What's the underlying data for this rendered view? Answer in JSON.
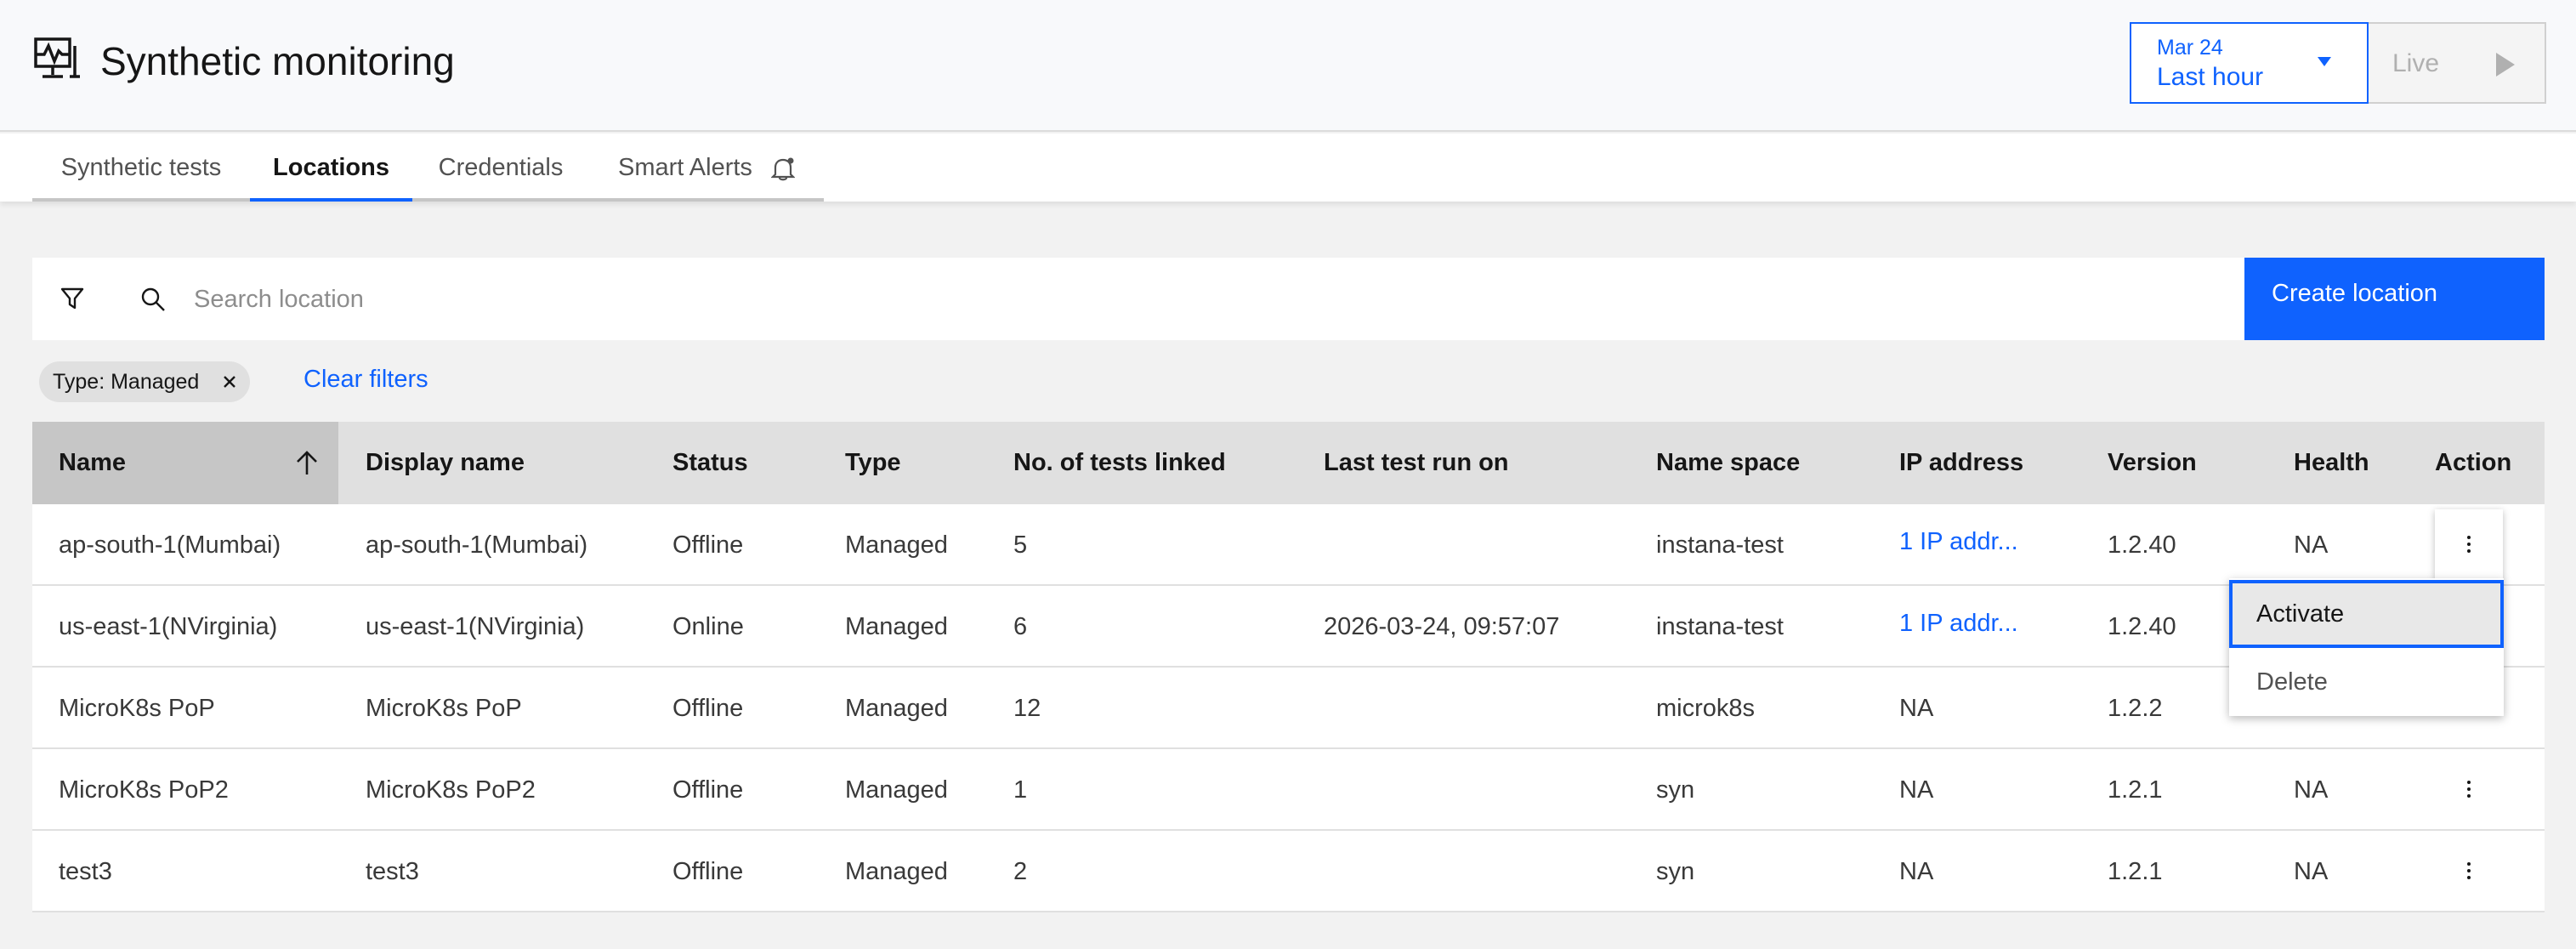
{
  "header": {
    "title": "Synthetic monitoring",
    "date_day": "Mar 24",
    "date_range": "Last hour",
    "live_label": "Live"
  },
  "tabs": [
    {
      "label": "Synthetic tests"
    },
    {
      "label": "Locations"
    },
    {
      "label": "Credentials"
    },
    {
      "label": "Smart Alerts"
    }
  ],
  "active_tab": "Locations",
  "toolbar": {
    "search_placeholder": "Search location",
    "create_label": "Create location"
  },
  "filters": {
    "tag_label": "Type: Managed",
    "clear_label": "Clear filters"
  },
  "table": {
    "columns": [
      "Name",
      "Display name",
      "Status",
      "Type",
      "No. of tests linked",
      "Last test run on",
      "Name space",
      "IP address",
      "Version",
      "Health",
      "Action"
    ],
    "rows": [
      {
        "name": "ap-south-1(Mumbai)",
        "display": "ap-south-1(Mumbai)",
        "status": "Offline",
        "type": "Managed",
        "tests": "5",
        "last_run": "",
        "namespace": "instana-test",
        "ip": "1 IP addr...",
        "version": "1.2.40",
        "health": "NA"
      },
      {
        "name": "us-east-1(NVirginia)",
        "display": "us-east-1(NVirginia)",
        "status": "Online",
        "type": "Managed",
        "tests": "6",
        "last_run": "2026-03-24, 09:57:07",
        "namespace": "instana-test",
        "ip": "1 IP addr...",
        "version": "1.2.40",
        "health": ""
      },
      {
        "name": "MicroK8s PoP",
        "display": "MicroK8s PoP",
        "status": "Offline",
        "type": "Managed",
        "tests": "12",
        "last_run": "",
        "namespace": "microk8s",
        "ip": "NA",
        "version": "1.2.2",
        "health": ""
      },
      {
        "name": "MicroK8s PoP2",
        "display": "MicroK8s PoP2",
        "status": "Offline",
        "type": "Managed",
        "tests": "1",
        "last_run": "",
        "namespace": "syn",
        "ip": "NA",
        "version": "1.2.1",
        "health": "NA"
      },
      {
        "name": "test3",
        "display": "test3",
        "status": "Offline",
        "type": "Managed",
        "tests": "2",
        "last_run": "",
        "namespace": "syn",
        "ip": "NA",
        "version": "1.2.1",
        "health": "NA"
      }
    ]
  },
  "action_menu": {
    "items": [
      "Activate",
      "Delete"
    ]
  },
  "colors": {
    "accent": "#0f62fe",
    "header_bg": "#f8f9fb",
    "table_header_bg": "#e0e0e0",
    "sorted_header_bg": "#c6c6c6"
  },
  "icons": {
    "app": "monitor-activity-icon",
    "bell": "notification-bell-icon",
    "filter": "filter-icon",
    "search": "search-icon",
    "sort": "arrow-up-icon",
    "overflow": "overflow-menu-vertical-icon"
  }
}
